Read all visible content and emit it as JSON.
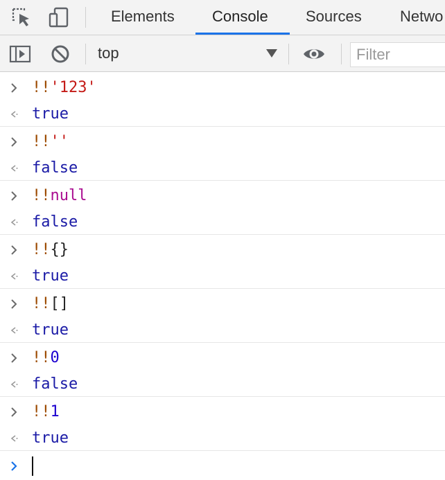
{
  "tabs": [
    {
      "label": "Elements",
      "active": false
    },
    {
      "label": "Console",
      "active": true
    },
    {
      "label": "Sources",
      "active": false
    },
    {
      "label": "Netwo",
      "active": false
    }
  ],
  "toolbar": {
    "context": "top",
    "filter_placeholder": "Filter"
  },
  "entries": [
    {
      "op": "!!",
      "value": "'123'",
      "type": "str",
      "result": "true"
    },
    {
      "op": "!!",
      "value": "''",
      "type": "str",
      "result": "false"
    },
    {
      "op": "!!",
      "value": "null",
      "type": "kw",
      "result": "false"
    },
    {
      "op": "!!",
      "value": "{}",
      "type": "plain",
      "result": "true"
    },
    {
      "op": "!!",
      "value": "[]",
      "type": "plain",
      "result": "true"
    },
    {
      "op": "!!",
      "value": "0",
      "type": "num",
      "result": "false"
    },
    {
      "op": "!!",
      "value": "1",
      "type": "num",
      "result": "true"
    }
  ],
  "colors": {
    "accent": "#1a73e8",
    "result": "#1a1aa6",
    "string": "#c41a16",
    "keyword": "#aa0d91",
    "number": "#1c00cf",
    "operator": "#9c4a00"
  },
  "icons": [
    "inspect-element-icon",
    "device-toolbar-icon",
    "sidebar-toggle-icon",
    "clear-console-icon",
    "dropdown-caret-icon",
    "live-expression-eye-icon",
    "input-chevron-icon",
    "result-chevron-icon",
    "prompt-chevron-icon"
  ]
}
